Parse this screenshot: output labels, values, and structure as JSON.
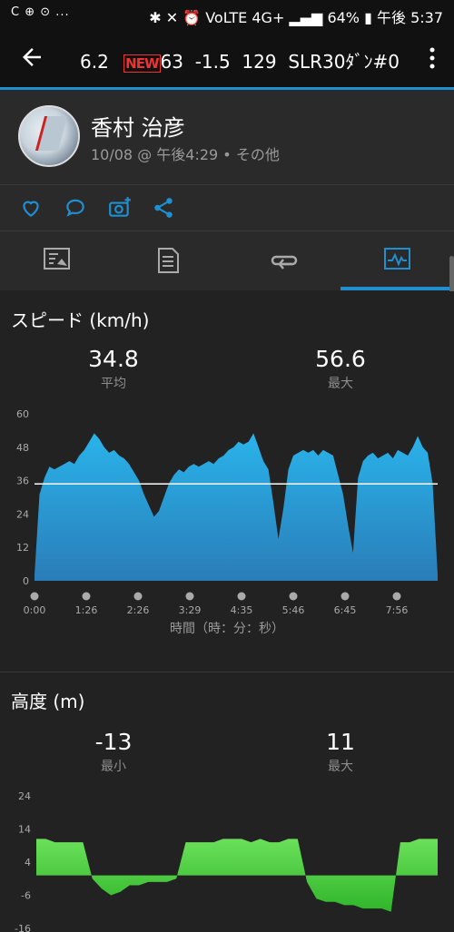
{
  "status_bar": {
    "left_icons": "C ⊕ ⊙ ...",
    "right_text": "✱ ✕ ⏰ VoLTE 4G+ ▂▄▆ 64% ▮ 午後 5:37"
  },
  "app_bar": {
    "title": "6.2 NEW63 -1.5 129 SLR30ﾀﾞﾝ#0",
    "new_badge": "NEW",
    "title_prefix": "6.2",
    "title_suffix": "63  -1.5  129  SLR30ﾀﾞﾝ#0"
  },
  "user": {
    "name": "香村 治彦",
    "subline": "10/08 @ 午後4:29 • その他"
  },
  "tabs": [
    "overview-icon",
    "details-icon",
    "laps-icon",
    "charts-icon"
  ],
  "speed": {
    "title": "スピード (km/h)",
    "avg_value": "34.8",
    "avg_label": "平均",
    "max_value": "56.6",
    "max_label": "最大",
    "x_axis_label": "時間（時：分：秒）"
  },
  "altitude": {
    "title": "高度 (m)",
    "min_value": "-13",
    "min_label": "最小",
    "max_value": "11",
    "max_label": "最大"
  },
  "chart_data": [
    {
      "type": "area",
      "title": "スピード (km/h)",
      "xlabel": "時間（時：分：秒）",
      "ylabel": "",
      "y_ticks": [
        "60",
        "48",
        "36",
        "24",
        "12",
        "0"
      ],
      "ylim": [
        0,
        60
      ],
      "x_ticks": [
        "0:00",
        "1:26",
        "2:26",
        "3:29",
        "4:35",
        "5:46",
        "6:45",
        "7:56"
      ],
      "reference_line": 34.8,
      "color": "#29a8e0",
      "values": [
        2,
        31,
        37,
        41,
        40,
        41,
        42,
        43,
        42,
        45,
        47,
        50,
        53,
        51,
        48,
        46,
        47,
        45,
        44,
        42,
        39,
        36,
        31,
        27,
        23,
        25,
        30,
        35,
        38,
        40,
        39,
        41,
        42,
        41,
        42,
        43,
        42,
        44,
        45,
        47,
        48,
        50,
        49,
        50,
        53,
        48,
        43,
        40,
        28,
        15,
        26,
        40,
        45,
        46,
        47,
        46,
        47,
        45,
        47,
        46,
        45,
        38,
        31,
        20,
        10,
        37,
        43,
        45,
        46,
        44,
        45,
        46,
        44,
        47,
        46,
        45,
        48,
        52,
        48,
        46,
        35,
        2
      ]
    },
    {
      "type": "area",
      "title": "高度 (m)",
      "ylim": [
        -16,
        24
      ],
      "y_ticks": [
        "24",
        "14",
        "4",
        "-6",
        "-16"
      ],
      "color": "#4cd137",
      "values": [
        11,
        11,
        10,
        10,
        10,
        10,
        -1,
        -4,
        -6,
        -5,
        -3,
        -3,
        -2,
        -2,
        -2,
        -1,
        10,
        10,
        10,
        10,
        11,
        11,
        11,
        10,
        11,
        10,
        10,
        11,
        11,
        -2,
        -7,
        -8,
        -8,
        -9,
        -9,
        -10,
        -10,
        -10,
        -11,
        10,
        10,
        11,
        11,
        11
      ]
    }
  ]
}
